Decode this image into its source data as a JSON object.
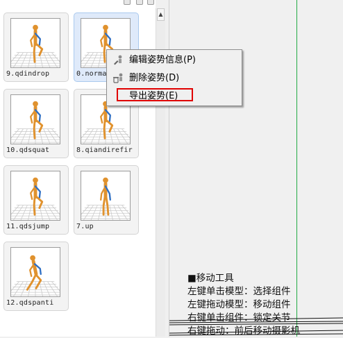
{
  "pose_library": {
    "cards": [
      {
        "label": "9.qdindrop",
        "pose": "knee-up"
      },
      {
        "label": "0.normal",
        "pose": "knee-up",
        "selected": true
      },
      {
        "label": "10.qdsquat",
        "pose": "knee-up"
      },
      {
        "label": "8.qiandirefir",
        "pose": "knee-up"
      },
      {
        "label": "11.qdsjump",
        "pose": "knee-up"
      },
      {
        "label": "7.up",
        "pose": "stand"
      },
      {
        "label": "12.qdspanti",
        "pose": "kneel-sit"
      }
    ]
  },
  "context_menu": {
    "items": [
      {
        "label": "编辑姿势信息(P)",
        "icon": "edit-pose-icon"
      },
      {
        "label": "删除姿势(D)",
        "icon": "delete-pose-icon"
      },
      {
        "label": "导出姿势(E)",
        "icon": "",
        "highlighted": true
      }
    ]
  },
  "hint_panel": {
    "title": "■移动工具",
    "lines": [
      "左键单击模型：选择组件",
      "左键拖动模型：移动组件",
      "右键单击组件：锁定关节",
      "右键拖动：前后移动摄影机"
    ]
  },
  "colors": {
    "figure": "#e0922e",
    "figure_accent": "#2e6fc4",
    "highlight_box": "#e00000",
    "guide_line": "#22aa44",
    "selected_card": "#dfeafa"
  }
}
